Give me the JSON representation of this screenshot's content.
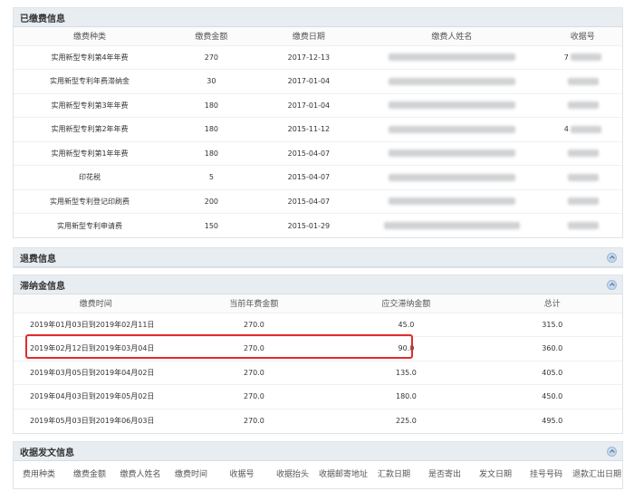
{
  "paid": {
    "title": "已缴费信息",
    "columns": [
      "缴费种类",
      "缴费金额",
      "缴费日期",
      "缴费人姓名",
      "收据号"
    ],
    "rows": [
      {
        "type": "实用新型专利第4年年费",
        "amount": "270",
        "date": "2017-12-13",
        "receipt": "7"
      },
      {
        "type": "实用新型专利年费滞纳金",
        "amount": "30",
        "date": "2017-01-04",
        "receipt": ""
      },
      {
        "type": "实用新型专利第3年年费",
        "amount": "180",
        "date": "2017-01-04",
        "receipt": ""
      },
      {
        "type": "实用新型专利第2年年费",
        "amount": "180",
        "date": "2015-11-12",
        "receipt": "4"
      },
      {
        "type": "实用新型专利第1年年费",
        "amount": "180",
        "date": "2015-04-07",
        "receipt": ""
      },
      {
        "type": "印花税",
        "amount": "5",
        "date": "2015-04-07",
        "receipt": ""
      },
      {
        "type": "实用新型专利登记印刷费",
        "amount": "200",
        "date": "2015-04-07",
        "receipt": ""
      },
      {
        "type": "实用新型专利申请费",
        "amount": "150",
        "date": "2015-01-29",
        "receipt": ""
      }
    ]
  },
  "refund": {
    "title": "退费信息"
  },
  "late": {
    "title": "滞纳金信息",
    "columns": [
      "缴费时间",
      "当前年费金额",
      "应交滞纳金额",
      "总计"
    ],
    "rows": [
      {
        "period": "2019年01月03日到2019年02月11日",
        "annual": "270.0",
        "late": "45.0",
        "total": "315.0"
      },
      {
        "period": "2019年02月12日到2019年03月04日",
        "annual": "270.0",
        "late": "90.0",
        "total": "360.0"
      },
      {
        "period": "2019年03月05日到2019年04月02日",
        "annual": "270.0",
        "late": "135.0",
        "total": "405.0"
      },
      {
        "period": "2019年04月03日到2019年05月02日",
        "annual": "270.0",
        "late": "180.0",
        "total": "450.0"
      },
      {
        "period": "2019年05月03日到2019年06月03日",
        "annual": "270.0",
        "late": "225.0",
        "total": "495.0"
      }
    ]
  },
  "receipt": {
    "title": "收据发文信息",
    "columns": [
      "费用种类",
      "缴费金额",
      "缴费人姓名",
      "缴费时间",
      "收据号",
      "收据抬头",
      "收据邮寄地址",
      "汇款日期",
      "是否寄出",
      "发文日期",
      "挂号号码",
      "退款汇出日期"
    ]
  },
  "colors": {
    "highlight": "#e02b2b",
    "header_bg": "#e8edf2"
  }
}
